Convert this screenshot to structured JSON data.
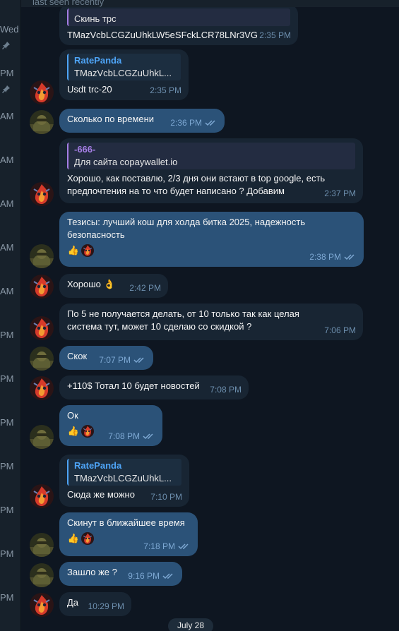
{
  "header": {
    "status": "last seen recently"
  },
  "sidebar": {
    "times": [
      "Wed",
      "PM",
      "AM",
      "AM",
      "AM",
      "AM",
      "AM",
      "PM",
      "PM",
      "PM",
      "PM",
      "PM",
      "PM",
      "PM"
    ]
  },
  "messages": [
    {
      "reply_text": "Скинь трс",
      "text": "TMazVcbLCGZuUhkLW5eSFckLCR78LNr3VG",
      "time": "2:35 PM"
    },
    {
      "reply_name": "RatePanda",
      "reply_text": "TMazVcbLCGZuUhkL...",
      "text": "Usdt trc-20",
      "time": "2:35 PM"
    },
    {
      "text": "Сколько по времени",
      "time": "2:36 PM"
    },
    {
      "reply_name": "-666-",
      "reply_text": "Для сайта copaywallet.io",
      "text": "Хорошо, как поставлю, 2/3 дня они встают в top google, есть предпочтения на то что будет написано ? Добавим",
      "time": "2:37 PM"
    },
    {
      "text": "Тезисы: лучший кош для холда битка 2025, надежность безопасность",
      "time": "2:38 PM"
    },
    {
      "text": "Хорошо 👌",
      "time": "2:42 PM"
    },
    {
      "text": "По 5 не получается делать, от 10 только так как целая система тут, может 10 сделаю со скидкой ?",
      "time": "7:06 PM"
    },
    {
      "text": "Скок",
      "time": "7:07 PM"
    },
    {
      "text": "+110$ Тотал 10 будет новостей",
      "time": "7:08 PM"
    },
    {
      "text": "Ок",
      "time": "7:08 PM"
    },
    {
      "reply_name": "RatePanda",
      "reply_text": "TMazVcbLCGZuUhkL...",
      "text": "Сюда же можно",
      "time": "7:10 PM"
    },
    {
      "text": "Скинут в ближайшее время",
      "time": "7:18 PM"
    },
    {
      "text": "Зашло же ?",
      "time": "9:16 PM"
    },
    {
      "text": "Да",
      "time": "10:29 PM"
    }
  ],
  "date_pill": "July 28",
  "colors": {
    "bg": "#0e1621",
    "incoming": "#182533",
    "outgoing": "#2b5278",
    "accent": "#4ea4f6",
    "purple": "#a57ee5"
  },
  "icons": {
    "pin": "pin-icon",
    "read": "double-check-icon",
    "reaction_like": "thumbs-up",
    "reaction_fire": "fire"
  }
}
